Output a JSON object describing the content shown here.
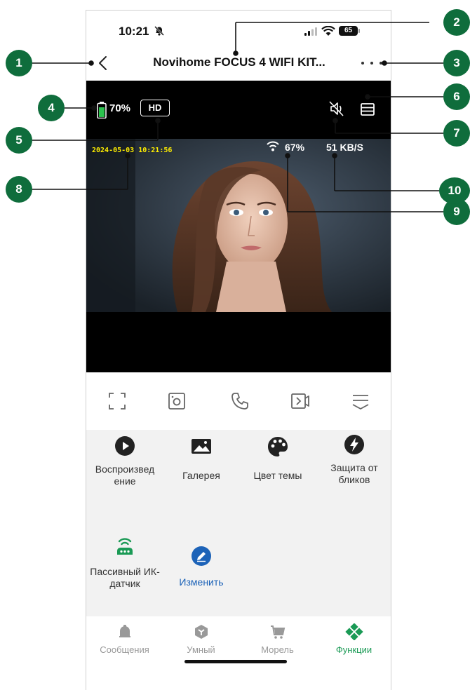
{
  "status_bar": {
    "time": "10:21",
    "battery_level": "65"
  },
  "header": {
    "title": "Novihome FOCUS 4 WIFI KIT..."
  },
  "video": {
    "battery_percent": "70%",
    "quality": "HD",
    "timestamp": "2024-05-03 10:21:56",
    "signal_strength": "67%",
    "bitrate": "51 KB/S"
  },
  "toolbar": {
    "icons": [
      "fullscreen-icon",
      "screenshot-icon",
      "phone-icon",
      "record-icon",
      "expand-icon"
    ]
  },
  "features": [
    {
      "label": "Воспроизвед ение",
      "icon": "play-icon"
    },
    {
      "label": "Галерея",
      "icon": "gallery-icon"
    },
    {
      "label": "Цвет темы",
      "icon": "palette-icon"
    },
    {
      "label": "Защита от бликов",
      "icon": "lightning-icon"
    },
    {
      "label": "Пассивный ИК-датчик",
      "icon": "pir-sensor-icon"
    },
    {
      "label": "Изменить",
      "icon": "edit-icon"
    }
  ],
  "bottom_nav": [
    {
      "label": "Сообщения",
      "icon": "bell-icon"
    },
    {
      "label": "Умный",
      "icon": "cube-icon"
    },
    {
      "label": "Морель",
      "icon": "cart-icon"
    },
    {
      "label": "Функции",
      "icon": "functions-icon",
      "active": true
    }
  ],
  "callouts": [
    "1",
    "2",
    "3",
    "4",
    "5",
    "6",
    "7",
    "8",
    "9",
    "10"
  ],
  "colors": {
    "accent": "#1a9a55",
    "callout": "#0f6d3c",
    "link": "#1d63b8",
    "timestamp": "#ffee00"
  }
}
